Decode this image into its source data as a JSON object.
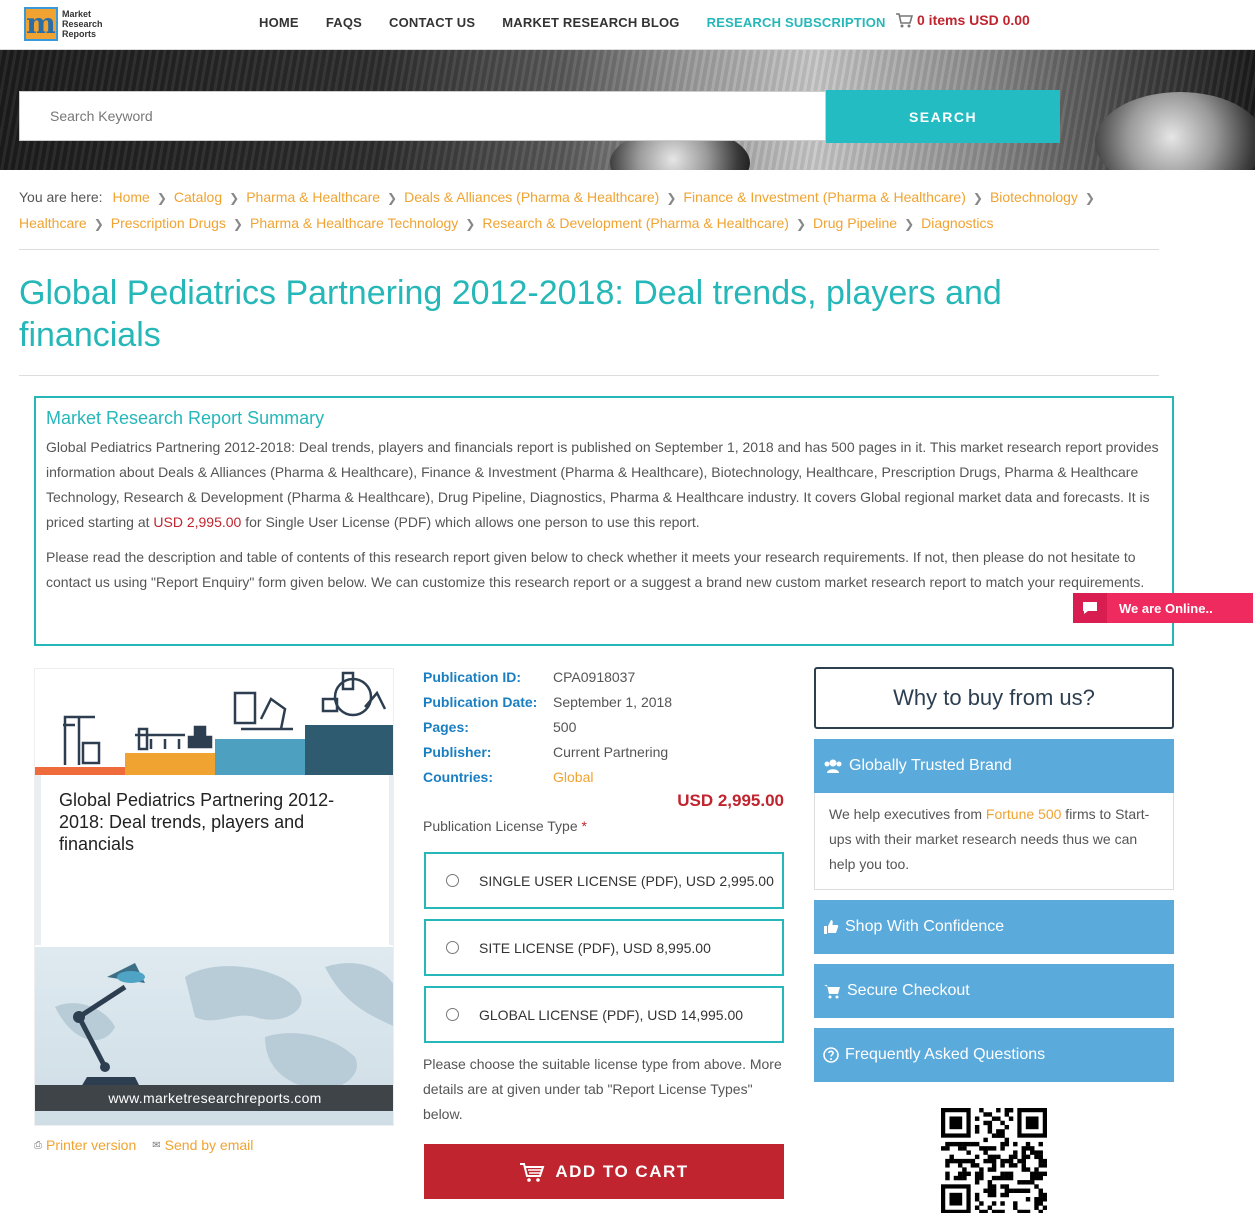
{
  "brand": {
    "logo_letter": "m",
    "logo_lines": [
      "Market",
      "Research",
      "Reports"
    ]
  },
  "nav": {
    "items": [
      {
        "label": "HOME"
      },
      {
        "label": "FAQS"
      },
      {
        "label": "CONTACT US"
      },
      {
        "label": "MARKET RESEARCH BLOG"
      },
      {
        "label": "RESEARCH SUBSCRIPTION"
      }
    ],
    "cart_label": "0 items USD 0.00"
  },
  "search": {
    "placeholder": "Search Keyword",
    "button": "SEARCH"
  },
  "breadcrumb": {
    "prefix": "You are here:",
    "items": [
      "Home",
      "Catalog",
      "Pharma & Healthcare",
      "Deals & Alliances (Pharma & Healthcare)",
      "Finance & Investment (Pharma & Healthcare)",
      "Biotechnology",
      "Healthcare",
      "Prescription Drugs",
      "Pharma & Healthcare Technology",
      "Research & Development (Pharma & Healthcare)",
      "Drug Pipeline",
      "Diagnostics"
    ]
  },
  "page": {
    "title": "Global Pediatrics Partnering 2012-2018: Deal trends, players and financials"
  },
  "summary": {
    "heading": "Market Research Report Summary",
    "p1_before": "Global Pediatrics Partnering 2012-2018: Deal trends, players and financials report is published on September 1, 2018 and has 500 pages in it. This market research report provides information about Deals & Alliances (Pharma & Healthcare), Finance & Investment (Pharma & Healthcare), Biotechnology, Healthcare, Prescription Drugs, Pharma & Healthcare Technology, Research & Development (Pharma & Healthcare), Drug Pipeline, Diagnostics, Pharma & Healthcare industry. It covers Global regional market data and forecasts. It is priced starting at ",
    "p1_price": "USD 2,995.00",
    "p1_after": " for Single User License (PDF) which allows one person to use this report.",
    "p2": "Please read the description and table of contents of this research report given below to check whether it meets your research requirements. If not, then please do not hesitate to contact us using \"Report Enquiry\" form given below. We can customize this research report or a suggest a brand new custom market research report to match your requirements."
  },
  "chat": {
    "label": "We are Online.."
  },
  "product_card": {
    "title": "Global Pediatrics Partnering 2012-2018: Deal trends, players and financials",
    "url": "www.marketresearchreports.com"
  },
  "links": {
    "printer": "Printer version",
    "email": "Send by email"
  },
  "details": {
    "rows": [
      {
        "label": "Publication ID:",
        "value": "CPA0918037"
      },
      {
        "label": "Publication Date:",
        "value": "September 1, 2018"
      },
      {
        "label": "Pages:",
        "value": "500"
      },
      {
        "label": "Publisher:",
        "value": "Current Partnering"
      },
      {
        "label": "Countries:",
        "value": "Global"
      }
    ],
    "price": "USD 2,995.00",
    "license_type_label": "Publication License Type",
    "required_mark": "*",
    "licenses": [
      {
        "label": "SINGLE USER LICENSE (PDF), USD 2,995.00"
      },
      {
        "label": "SITE LICENSE (PDF), USD 8,995.00"
      },
      {
        "label": "GLOBAL LICENSE (PDF), USD 14,995.00"
      }
    ],
    "note": "Please choose the suitable license type from above. More details are at given under tab \"Report License Types\" below.",
    "add_to_cart": "ADD TO CART"
  },
  "why_buy": {
    "heading": "Why to buy from us?",
    "trusted_title": "Globally Trusted Brand",
    "trusted_before": "We help executives from ",
    "trusted_highlight": "Fortune 500",
    "trusted_after": " firms to Start-ups with their market research needs thus we can help you too.",
    "shop": "Shop With Confidence",
    "checkout": "Secure Checkout",
    "faq": "Frequently Asked Questions"
  },
  "colors": {
    "teal": "#26b7b9",
    "orange": "#f0a330",
    "red": "#c0242f",
    "blue": "#5aaadc",
    "navy": "#2d3e50"
  }
}
